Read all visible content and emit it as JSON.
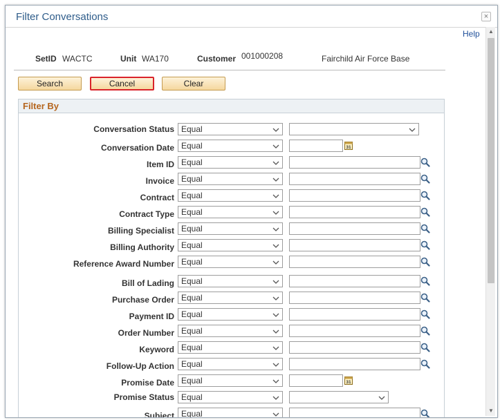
{
  "dialog": {
    "title": "Filter Conversations",
    "close_glyph": "×",
    "help": "Help"
  },
  "header": {
    "setid_label": "SetID",
    "setid_value": "WACTC",
    "unit_label": "Unit",
    "unit_value": "WA170",
    "customer_label": "Customer",
    "customer_value": "001000208",
    "customer_name": "Fairchild Air Force Base"
  },
  "buttons": {
    "search": "Search",
    "cancel": "Cancel",
    "clear": "Clear"
  },
  "section": {
    "title": "Filter By"
  },
  "filters": [
    {
      "label": "Conversation Status",
      "operator": "Equal",
      "value_type": "dropdown"
    },
    {
      "label": "Conversation Date",
      "operator": "Equal",
      "value_type": "date"
    },
    {
      "label": "Item ID",
      "operator": "Equal",
      "value_type": "lookup"
    },
    {
      "label": "Invoice",
      "operator": "Equal",
      "value_type": "lookup"
    },
    {
      "label": "Contract",
      "operator": "Equal",
      "value_type": "lookup"
    },
    {
      "label": "Contract Type",
      "operator": "Equal",
      "value_type": "lookup"
    },
    {
      "label": "Billing Specialist",
      "operator": "Equal",
      "value_type": "lookup"
    },
    {
      "label": "Billing Authority",
      "operator": "Equal",
      "value_type": "lookup"
    },
    {
      "label": "Reference Award Number",
      "operator": "Equal",
      "value_type": "lookup"
    },
    {
      "label": "Bill of Lading",
      "operator": "Equal",
      "value_type": "lookup"
    },
    {
      "label": "Purchase Order",
      "operator": "Equal",
      "value_type": "lookup"
    },
    {
      "label": "Payment ID",
      "operator": "Equal",
      "value_type": "lookup"
    },
    {
      "label": "Order Number",
      "operator": "Equal",
      "value_type": "lookup"
    },
    {
      "label": "Keyword",
      "operator": "Equal",
      "value_type": "lookup"
    },
    {
      "label": "Follow-Up Action",
      "operator": "Equal",
      "value_type": "lookup"
    },
    {
      "label": "Promise Date",
      "operator": "Equal",
      "value_type": "date"
    },
    {
      "label": "Promise Status",
      "operator": "Equal",
      "value_type": "dropdown-short"
    },
    {
      "label": "Subject",
      "operator": "Equal",
      "value_type": "lookup"
    }
  ],
  "icons": {
    "search": "magnifier-icon",
    "calendar": "calendar-icon",
    "chevron": "chevron-down-icon",
    "calendar_text": "31"
  },
  "colors": {
    "title": "#2e5c8a",
    "section_title": "#b5651d",
    "button_fill": "#f5d79e",
    "focus_border": "#d9232a",
    "link": "#1f4f9a"
  }
}
